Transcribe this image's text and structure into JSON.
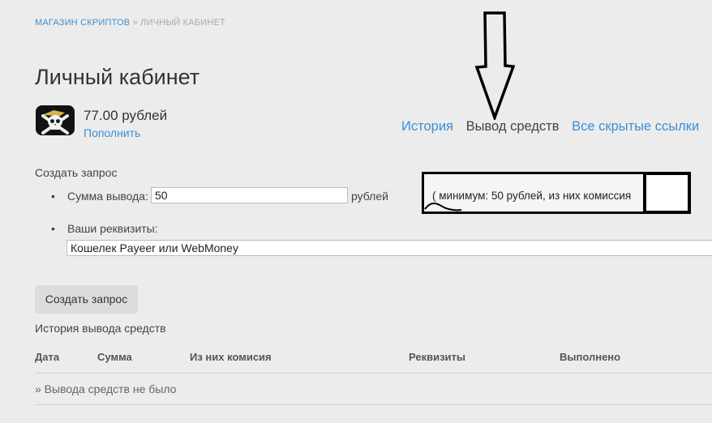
{
  "breadcrumb": {
    "store": "МАГАЗИН СКРИПТОВ",
    "separator": "»",
    "current": "ЛИЧНЫЙ КАБИНЕТ"
  },
  "page": {
    "title": "Личный кабинет"
  },
  "account": {
    "balance": "77.00 рублей",
    "topup_label": "Пополнить",
    "avatar_icon": "skull-crossbones-icon"
  },
  "tabs": [
    {
      "label": "История",
      "active": false
    },
    {
      "label": "Вывод средств",
      "active": true
    },
    {
      "label": "Все скрытые ссылки",
      "active": false
    }
  ],
  "form": {
    "title": "Создать запрос",
    "amount_label": "Сумма вывода:",
    "amount_value": "50",
    "amount_unit": "рублей",
    "min_note": "( минимум: 50 рублей, из них комиссия",
    "requisites_label": "Ваши реквизиты:",
    "requisites_value": "Кошелек Payeer или WebMoney",
    "submit_label": "Создать запрос"
  },
  "history": {
    "title": "История вывода средств",
    "columns": [
      "Дата",
      "Сумма",
      "Из них комисия",
      "Реквизиты",
      "Выполнено"
    ],
    "empty_text": "» Вывода средств не было"
  },
  "colors": {
    "link": "#3a8fd6",
    "background": "#ececec",
    "annotation": "#000000"
  }
}
